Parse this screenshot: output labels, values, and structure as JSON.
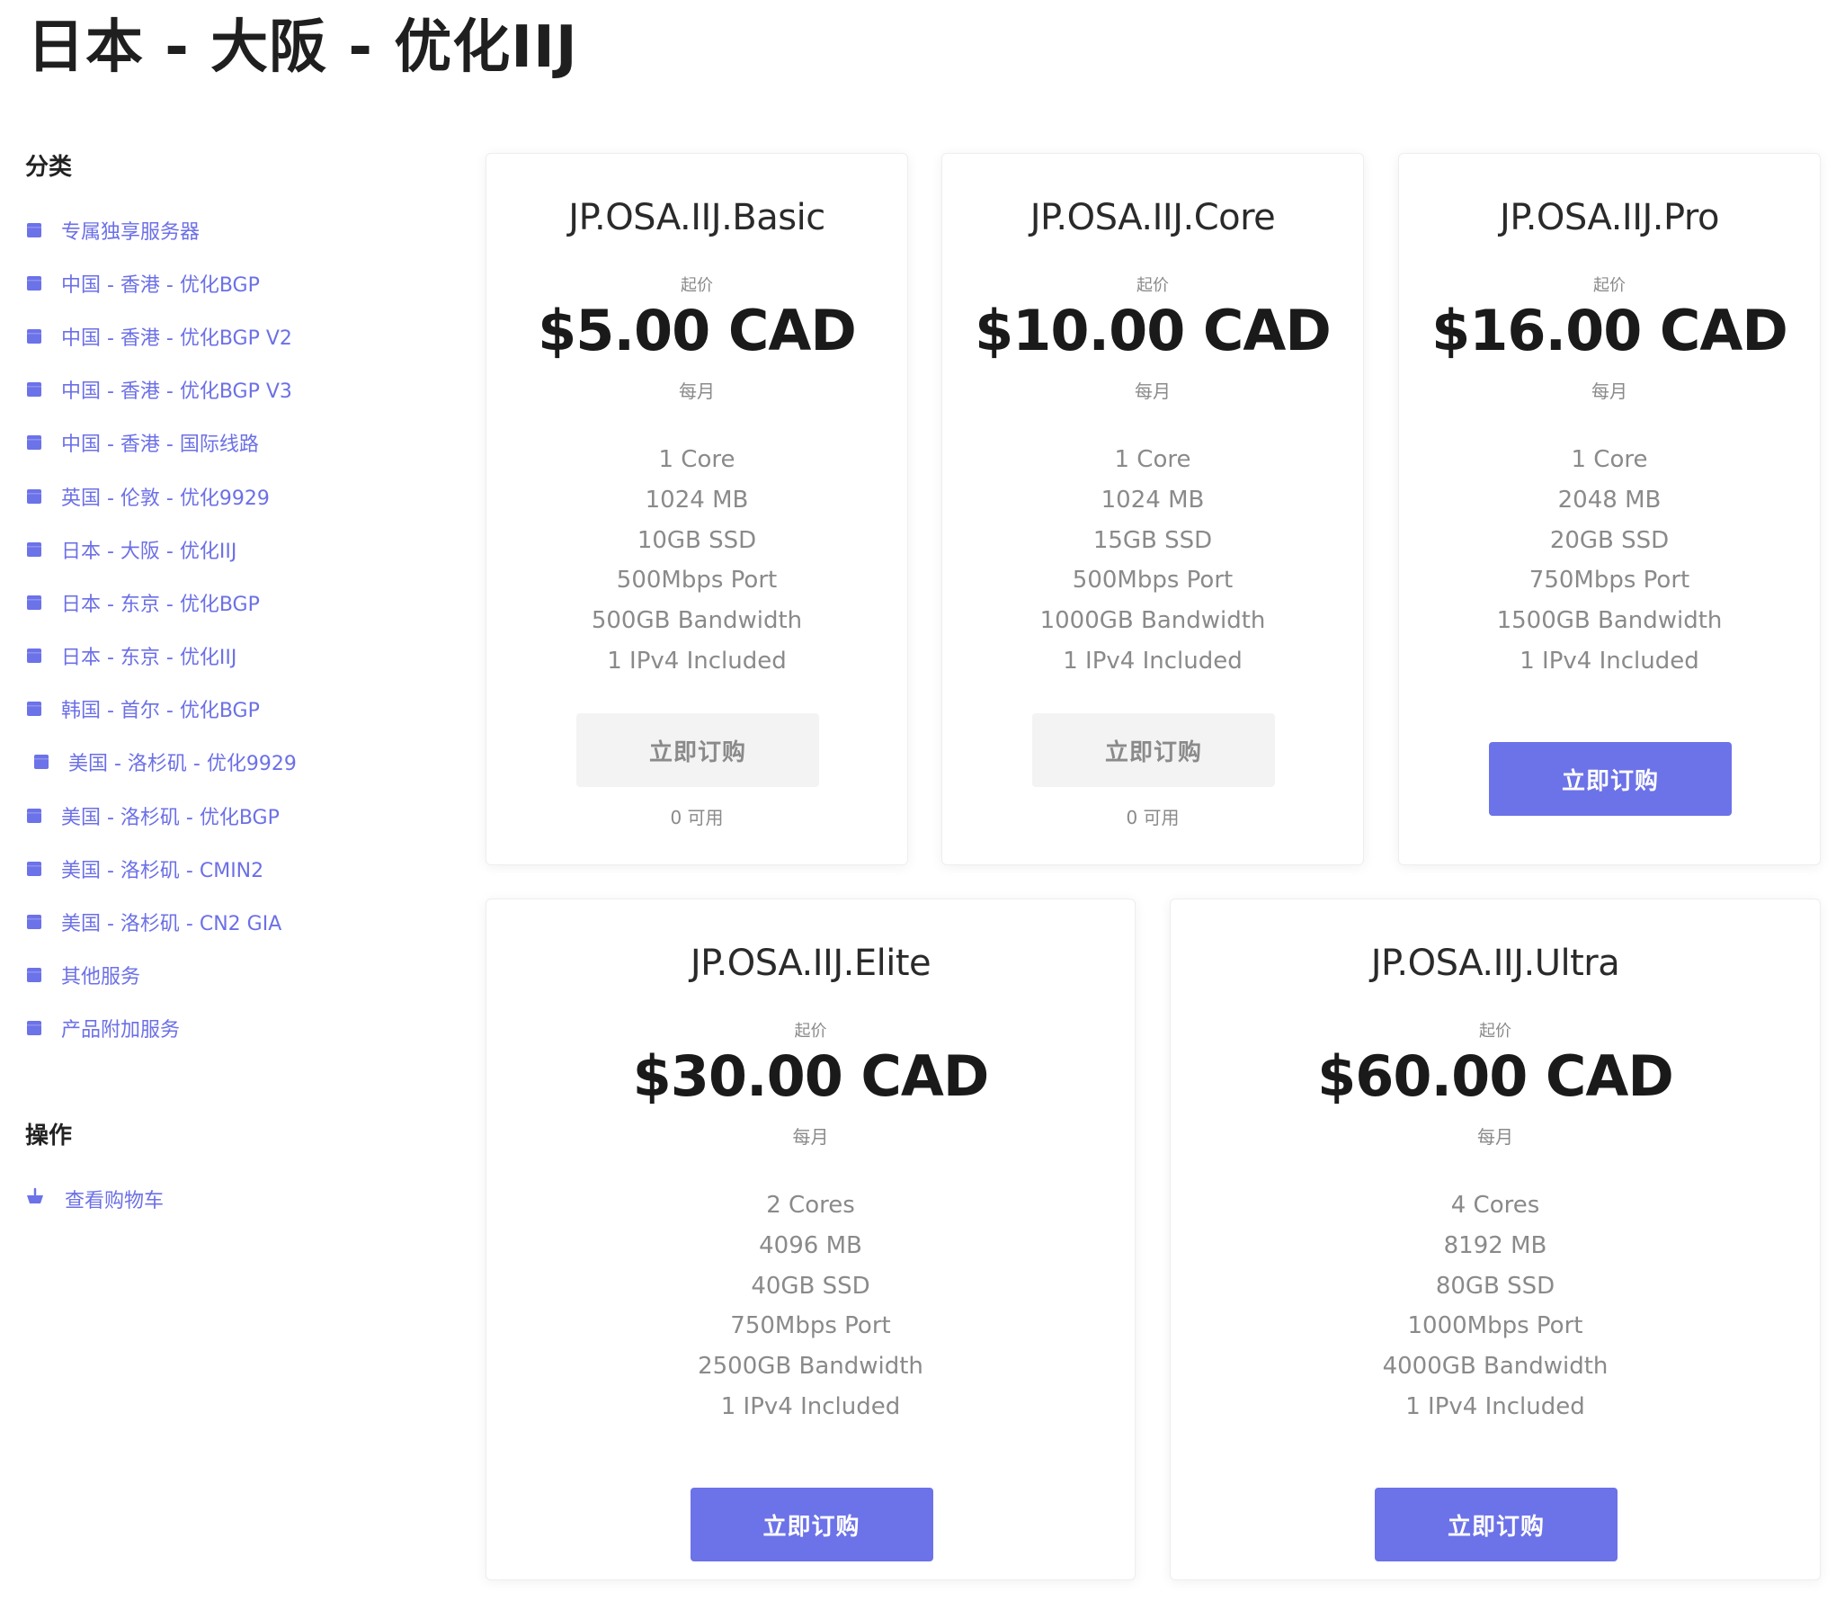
{
  "page": {
    "title": "日本 - 大阪 - 优化IIJ"
  },
  "colors": {
    "accent": "#6c72e8",
    "link": "#6c70e6",
    "muted": "#8a8a8a",
    "disabled_bg": "#f3f3f3"
  },
  "sidebar": {
    "categories_heading": "分类",
    "categories": [
      {
        "label": "专属独享服务器",
        "icon": "folder-icon"
      },
      {
        "label": "中国 - 香港 - 优化BGP",
        "icon": "folder-icon"
      },
      {
        "label": "中国 - 香港 - 优化BGP V2",
        "icon": "folder-icon"
      },
      {
        "label": "中国 - 香港 - 优化BGP V3",
        "icon": "folder-icon"
      },
      {
        "label": "中国 - 香港 - 国际线路",
        "icon": "folder-icon"
      },
      {
        "label": "英国 - 伦敦 - 优化9929",
        "icon": "folder-icon"
      },
      {
        "label": "日本 - 大阪 - 优化IIJ",
        "icon": "folder-icon"
      },
      {
        "label": "日本 - 东京 - 优化BGP",
        "icon": "folder-icon"
      },
      {
        "label": "日本 - 东京 - 优化IIJ",
        "icon": "folder-icon"
      },
      {
        "label": "韩国 - 首尔 - 优化BGP",
        "icon": "folder-icon"
      },
      {
        "label": "美国 - 洛杉矶 - 优化9929",
        "icon": "folder-icon"
      },
      {
        "label": "美国 - 洛杉矶 - 优化BGP",
        "icon": "folder-icon"
      },
      {
        "label": "美国 - 洛杉矶 - CMIN2",
        "icon": "folder-icon"
      },
      {
        "label": "美国 - 洛杉矶 - CN2 GIA",
        "icon": "folder-icon"
      },
      {
        "label": "其他服务",
        "icon": "folder-icon"
      },
      {
        "label": "产品附加服务",
        "icon": "folder-icon"
      }
    ],
    "actions_heading": "操作",
    "actions": [
      {
        "label": "查看购物车",
        "icon": "shopping-basket-icon"
      }
    ]
  },
  "products": [
    {
      "name": "JP.OSA.IIJ.Basic",
      "from_label": "起价",
      "price": "$5.00 CAD",
      "cycle": "每月",
      "features": [
        "1 Core",
        "1024 MB",
        "10GB SSD",
        "500Mbps Port",
        "500GB Bandwidth",
        "1 IPv4 Included"
      ],
      "button_label": "立即订购",
      "available": false,
      "availability": "0 可用"
    },
    {
      "name": "JP.OSA.IIJ.Core",
      "from_label": "起价",
      "price": "$10.00 CAD",
      "cycle": "每月",
      "features": [
        "1 Core",
        "1024 MB",
        "15GB SSD",
        "500Mbps Port",
        "1000GB Bandwidth",
        "1 IPv4 Included"
      ],
      "button_label": "立即订购",
      "available": false,
      "availability": "0 可用"
    },
    {
      "name": "JP.OSA.IIJ.Pro",
      "from_label": "起价",
      "price": "$16.00 CAD",
      "cycle": "每月",
      "features": [
        "1 Core",
        "2048 MB",
        "20GB SSD",
        "750Mbps Port",
        "1500GB Bandwidth",
        "1 IPv4 Included"
      ],
      "button_label": "立即订购",
      "available": true
    },
    {
      "name": "JP.OSA.IIJ.Elite",
      "from_label": "起价",
      "price": "$30.00 CAD",
      "cycle": "每月",
      "features": [
        "2 Cores",
        "4096 MB",
        "40GB SSD",
        "750Mbps Port",
        "2500GB Bandwidth",
        "1 IPv4 Included"
      ],
      "button_label": "立即订购",
      "available": true
    },
    {
      "name": "JP.OSA.IIJ.Ultra",
      "from_label": "起价",
      "price": "$60.00 CAD",
      "cycle": "每月",
      "features": [
        "4 Cores",
        "8192 MB",
        "80GB SSD",
        "1000Mbps Port",
        "4000GB Bandwidth",
        "1 IPv4 Included"
      ],
      "button_label": "立即订购",
      "available": true
    }
  ]
}
